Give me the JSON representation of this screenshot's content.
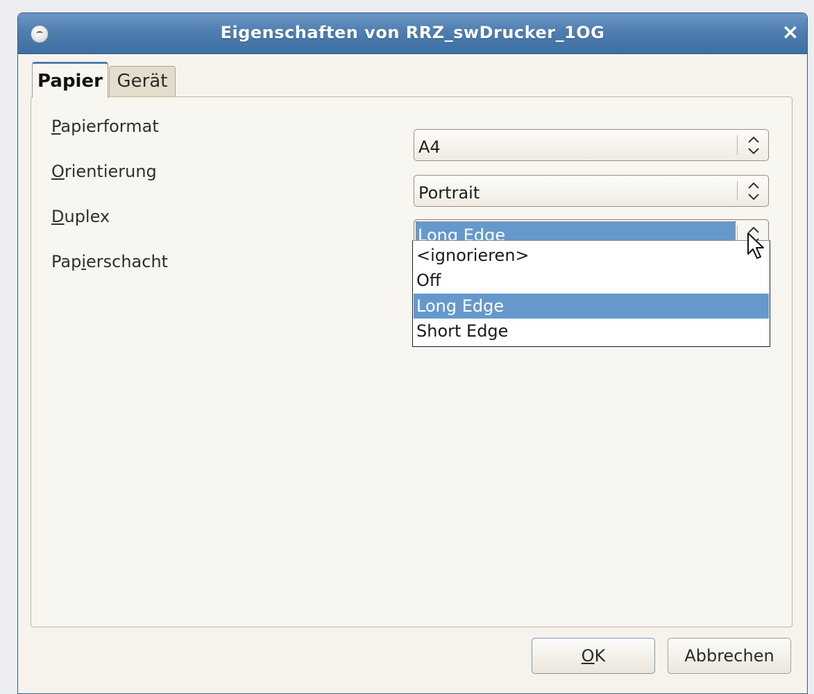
{
  "window": {
    "title": "Eigenschaften von RRZ_swDrucker_1OG"
  },
  "tabs": [
    {
      "label": "Papier",
      "active": true
    },
    {
      "label": "Gerät",
      "active": false
    }
  ],
  "fields": {
    "papierformat": {
      "label_mnemonic": "P",
      "label_rest": "apierformat",
      "value": "A4"
    },
    "orientierung": {
      "label_mnemonic": "O",
      "label_rest": "rientierung",
      "value": "Portrait"
    },
    "duplex": {
      "label_mnemonic": "D",
      "label_rest": "uplex",
      "value": "Long Edge"
    },
    "papierschacht": {
      "label_pre": "Pap",
      "label_mnemonic": "i",
      "label_rest": "erschacht"
    }
  },
  "duplex_options": [
    "<ignorieren>",
    "Off",
    "Long Edge",
    "Short Edge"
  ],
  "duplex_selected_index": 2,
  "buttons": {
    "ok_mnemonic": "O",
    "ok_rest": "K",
    "cancel": "Abbrechen"
  },
  "colors": {
    "titlebar": "#4f7eb0",
    "selection": "#6599cc",
    "dialog_bg": "#f8f6f0"
  }
}
